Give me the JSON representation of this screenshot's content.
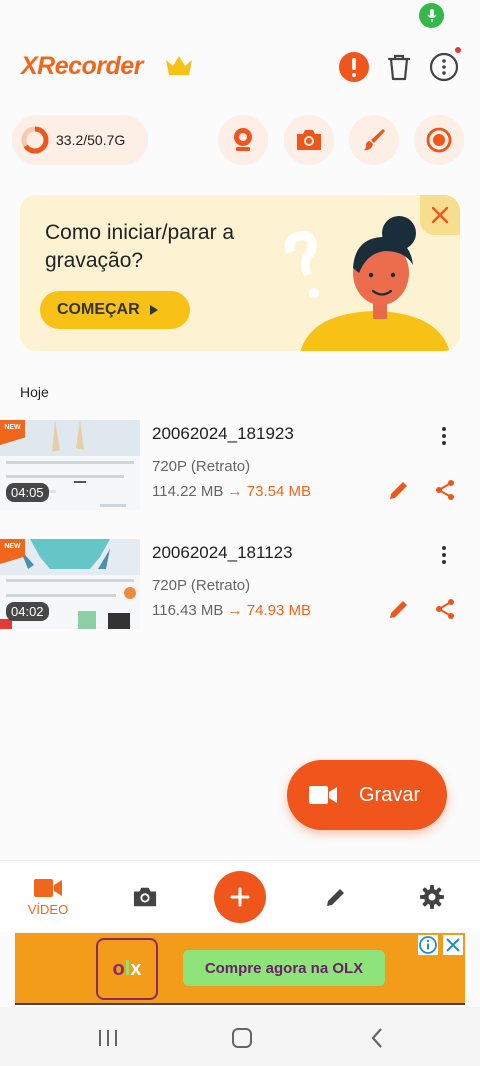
{
  "app": {
    "logo_text": "XRecorder",
    "accent_color": "#f0661b"
  },
  "storage": {
    "used_total": "33.2/50.7G",
    "used_fraction": 0.655
  },
  "promo": {
    "title": "Como iniciar/parar a gravação?",
    "button_label": "COMEÇAR"
  },
  "section": {
    "label": "Hoje"
  },
  "videos": [
    {
      "badge": "NEW",
      "title": "20062024_181923",
      "resolution": "720P (Retrato)",
      "original_size": "114.22 MB",
      "compressed_size": "73.54 MB",
      "duration": "04:05"
    },
    {
      "badge": "NEW",
      "title": "20062024_181123",
      "resolution": "720P (Retrato)",
      "original_size": "116.43 MB",
      "compressed_size": "74.93 MB",
      "duration": "04:02"
    }
  ],
  "record_button": {
    "label": "Gravar"
  },
  "bottom_nav": {
    "video_label": "VÍDEO"
  },
  "ad": {
    "logo_text": "olx",
    "cta_text": "Compre agora na OLX"
  },
  "icons": {
    "header": [
      "crown-icon",
      "alert-icon",
      "trash-icon",
      "more-vertical-icon"
    ],
    "tools": [
      "webcam-icon",
      "camera-icon",
      "brush-icon",
      "record-icon"
    ],
    "nav": [
      "video-icon",
      "camera-icon",
      "plus-icon",
      "pencil-icon",
      "gear-icon"
    ]
  }
}
